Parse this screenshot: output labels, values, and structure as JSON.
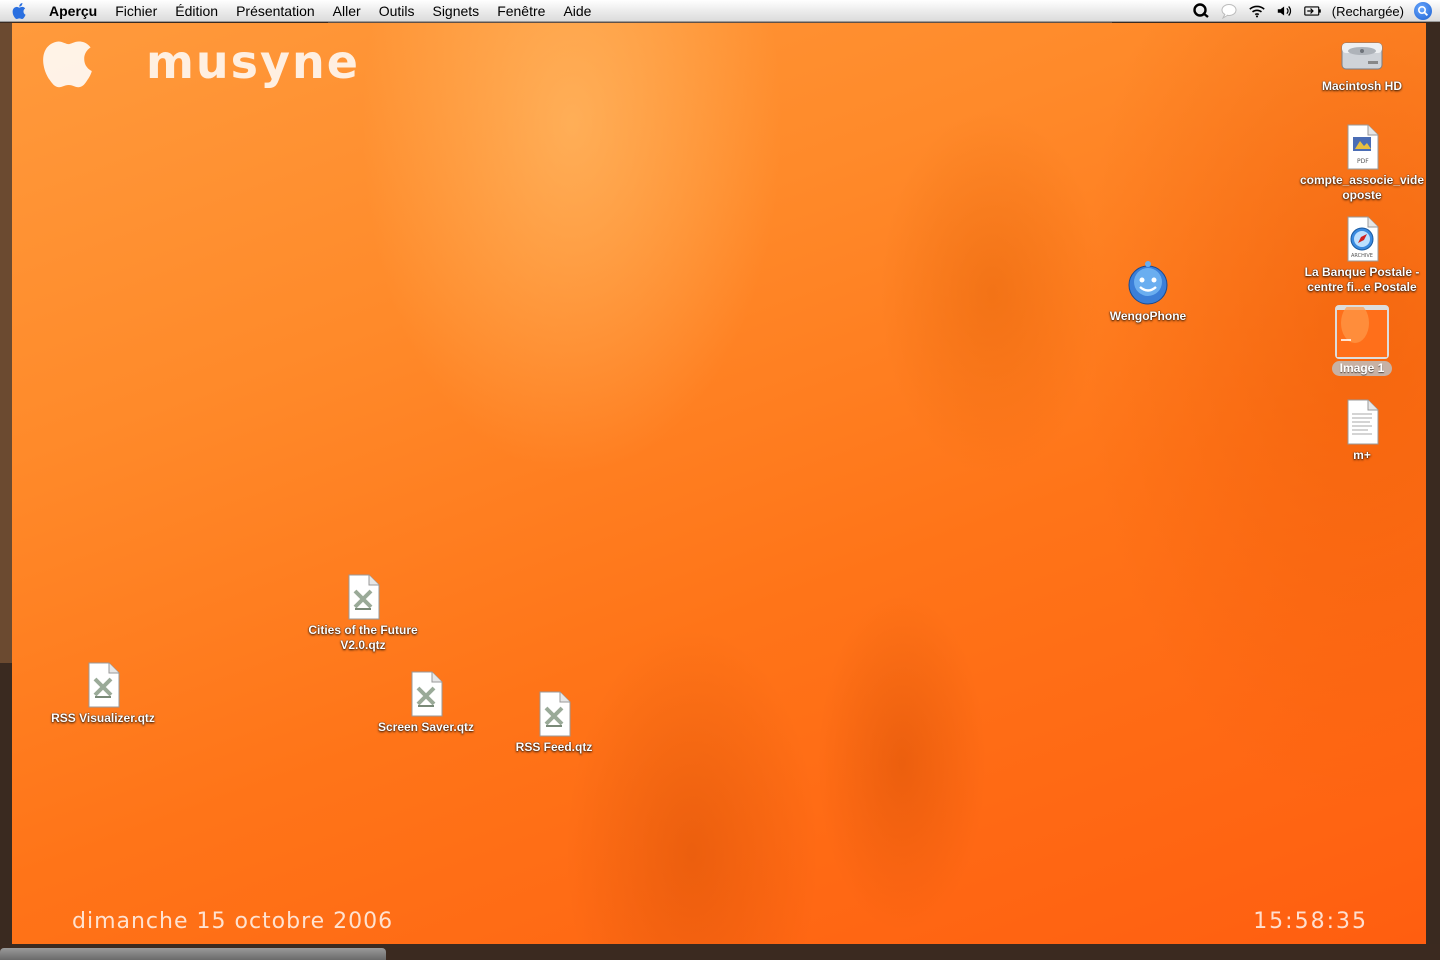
{
  "menubar": {
    "app_name": "Aperçu",
    "items": [
      "Fichier",
      "Édition",
      "Présentation",
      "Aller",
      "Outils",
      "Signets",
      "Fenêtre",
      "Aide"
    ],
    "battery_status": "(Rechargée)",
    "status_icons": [
      "qq-icon",
      "chat-bubble-icon",
      "wifi-icon",
      "volume-icon",
      "battery-icon",
      "spotlight-icon"
    ]
  },
  "desktop": {
    "brand": "musyne",
    "date": "dimanche 15 octobre 2006",
    "time": "15:58:35",
    "icons": [
      {
        "label": "Macintosh HD",
        "icon": "hard-drive-icon"
      },
      {
        "label": "compte_associe_videoposte",
        "icon": "pdf-document-icon"
      },
      {
        "label": "La Banque Postale - centre fi...e Postale",
        "icon": "safari-archive-icon"
      },
      {
        "label": "WengoPhone",
        "icon": "wengophone-icon"
      },
      {
        "label": "Image 1",
        "icon": "image-thumbnail-icon"
      },
      {
        "label": "m+",
        "icon": "text-document-icon"
      },
      {
        "label": "Cities of the Future V2.0.qtz",
        "icon": "qtz-file-icon"
      },
      {
        "label": "RSS Visualizer.qtz",
        "icon": "qtz-file-icon"
      },
      {
        "label": "Screen Saver.qtz",
        "icon": "qtz-file-icon"
      },
      {
        "label": "RSS Feed.qtz",
        "icon": "qtz-file-icon"
      }
    ]
  },
  "colors": {
    "desktop_orange": "#ff7418",
    "menubar_bg": "#ececec",
    "label_text": "#ffffff"
  }
}
